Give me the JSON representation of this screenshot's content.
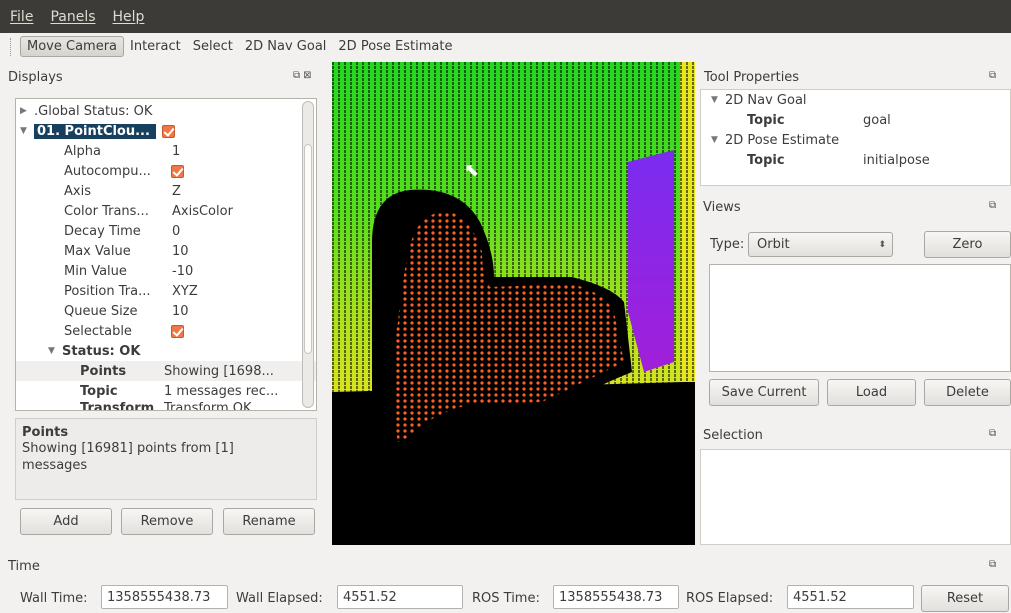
{
  "menu": {
    "file": "File",
    "panels": "Panels",
    "help": "Help"
  },
  "toolbar": {
    "move_camera": "Move Camera",
    "interact": "Interact",
    "select": "Select",
    "nav_goal": "2D Nav Goal",
    "pose_estimate": "2D Pose Estimate"
  },
  "displays": {
    "title": "Displays",
    "tree": {
      "global_status": ".Global Status: OK",
      "pointcloud": "01. PointClou...",
      "props": [
        {
          "name": "Alpha",
          "value": "1"
        },
        {
          "name": "Autocompu...",
          "value": ""
        },
        {
          "name": "Axis",
          "value": "Z"
        },
        {
          "name": "Color Trans...",
          "value": "AxisColor"
        },
        {
          "name": "Decay Time",
          "value": "0"
        },
        {
          "name": "Max Value",
          "value": "10"
        },
        {
          "name": "Min Value",
          "value": "-10"
        },
        {
          "name": "Position Tra...",
          "value": "XYZ"
        },
        {
          "name": "Queue Size",
          "value": "10"
        },
        {
          "name": "Selectable",
          "value": ""
        }
      ],
      "status": "Status: OK",
      "points_name": "Points",
      "points_value": "Showing [1698...",
      "topic_name": "Topic",
      "topic_value": "1 messages rec...",
      "transform_name": "Transform",
      "transform_value": "Transform OK"
    },
    "description": {
      "title": "Points",
      "text": "Showing [16981] points from [1] messages"
    },
    "buttons": {
      "add": "Add",
      "remove": "Remove",
      "rename": "Rename"
    }
  },
  "tool_properties": {
    "title": "Tool Properties",
    "nav_goal": "2D Nav Goal",
    "nav_topic_label": "Topic",
    "nav_topic_value": "goal",
    "pose_estimate": "2D Pose Estimate",
    "pose_topic_label": "Topic",
    "pose_topic_value": "initialpose"
  },
  "views": {
    "title": "Views",
    "type_label": "Type:",
    "type_value": "Orbit",
    "zero": "Zero",
    "save_current": "Save Current",
    "load": "Load",
    "delete": "Delete"
  },
  "selection": {
    "title": "Selection"
  },
  "time": {
    "title": "Time",
    "wall_time_label": "Wall Time:",
    "wall_time": "1358555438.73",
    "wall_elapsed_label": "Wall Elapsed:",
    "wall_elapsed": "4551.52",
    "ros_time_label": "ROS Time:",
    "ros_time": "1358555438.73",
    "ros_elapsed_label": "ROS Elapsed:",
    "ros_elapsed": "4551.52",
    "reset": "Reset"
  },
  "colors": {
    "menubar_bg": "#3c3b37",
    "selection_bg": "#17405f",
    "checkbox": "#f07746",
    "points_high": "#22e022",
    "points_person": "#ff5a1a",
    "points_door": "#8a2be2"
  }
}
